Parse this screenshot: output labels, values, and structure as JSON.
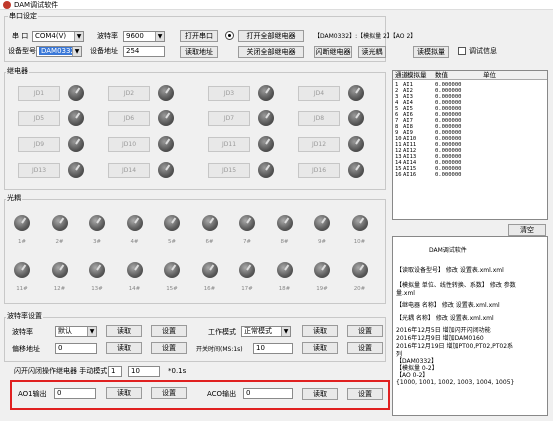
{
  "window": {
    "title": "DAM调试软件"
  },
  "serial": {
    "group_title": "串口设定",
    "port_label": "串  口",
    "port_value": "COM4(V)",
    "baud_label": "波特率",
    "baud_value": "9600",
    "open_port": "打开串口",
    "open_all": "打开全部继电器",
    "status_text": "【DAM0332】:【模拟量 2】【AO 2】",
    "device_model_label": "设备型号",
    "device_model_value": "DAM0332",
    "device_addr_label": "设备地址",
    "device_addr_value": "254",
    "read_addr": "读取地址",
    "close_all": "关闭全部继电器",
    "flash_relay": "闪断继电器",
    "read_optocoupler": "读光耦",
    "read_analog": "读模拟量",
    "debug_info": "调试信息"
  },
  "relays": {
    "group_title": "继电器",
    "items": [
      {
        "label": "JD1"
      },
      {
        "label": "JD2"
      },
      {
        "label": "JD3"
      },
      {
        "label": "JD4"
      },
      {
        "label": "JD5"
      },
      {
        "label": "JD6"
      },
      {
        "label": "JD7"
      },
      {
        "label": "JD8"
      },
      {
        "label": "JD9"
      },
      {
        "label": "JD10"
      },
      {
        "label": "JD11"
      },
      {
        "label": "JD12"
      },
      {
        "label": "JD13"
      },
      {
        "label": "JD14"
      },
      {
        "label": "JD15"
      },
      {
        "label": "JD16"
      }
    ]
  },
  "optocouplers": {
    "group_title": "光耦",
    "labels": [
      "1#",
      "2#",
      "3#",
      "4#",
      "5#",
      "6#",
      "7#",
      "8#",
      "9#",
      "10#",
      "11#",
      "12#",
      "13#",
      "14#",
      "15#",
      "16#",
      "17#",
      "18#",
      "19#",
      "20#"
    ]
  },
  "table": {
    "headers": [
      "通道",
      "模拟量",
      "数值",
      "单位"
    ],
    "rows": [
      {
        "ch": "1",
        "name": "AI1",
        "val": "0.000000"
      },
      {
        "ch": "2",
        "name": "AI2",
        "val": "0.000000"
      },
      {
        "ch": "3",
        "name": "AI3",
        "val": "0.000000"
      },
      {
        "ch": "4",
        "name": "AI4",
        "val": "0.000000"
      },
      {
        "ch": "5",
        "name": "AI5",
        "val": "0.000000"
      },
      {
        "ch": "6",
        "name": "AI6",
        "val": "0.000000"
      },
      {
        "ch": "7",
        "name": "AI7",
        "val": "0.000000"
      },
      {
        "ch": "8",
        "name": "AI8",
        "val": "0.000000"
      },
      {
        "ch": "9",
        "name": "AI9",
        "val": "0.000000"
      },
      {
        "ch": "10",
        "name": "AI10",
        "val": "0.000000"
      },
      {
        "ch": "11",
        "name": "AI11",
        "val": "0.000000"
      },
      {
        "ch": "12",
        "name": "AI12",
        "val": "0.000000"
      },
      {
        "ch": "13",
        "name": "AI13",
        "val": "0.000000"
      },
      {
        "ch": "14",
        "name": "AI14",
        "val": "0.000000"
      },
      {
        "ch": "15",
        "name": "AI15",
        "val": "0.000000"
      },
      {
        "ch": "16",
        "name": "AI16",
        "val": "0.000000"
      }
    ]
  },
  "clear_button": "清空",
  "info": {
    "lines": [
      "DAM调试软件",
      "【读取设备型号】 修改  设置表.xml.xml",
      "【模拟量 单位、线性转换、系数】 修改  参数",
      "量.xml",
      "【继电器 名称】 修改  设置表.xml.xml",
      "【光耦 名称】 修改  设置表.xml.xml",
      "2016年12月5日  增加闪开闪闭功能",
      "2016年12月9日  增加DAM0160",
      "2016年12月19日  增加PT00,PT02,PT02系",
      "列",
      "【DAM0332】",
      "  【模拟量 0-2】",
      "  【AO 0-2】",
      "  {1000, 1001, 1002, 1003, 1004, 1005}"
    ]
  },
  "baud_settings": {
    "group_title": "波特率设置",
    "baud_label": "波特率",
    "baud_value": "默认",
    "read": "读取",
    "set": "设置",
    "mode_label": "工作模式",
    "mode_value": "正常模式",
    "read2": "读取",
    "set2": "设置",
    "addr_label": "偏移地址",
    "addr_value": "0",
    "read3": "读取",
    "set3": "设置",
    "switch_label": "开关时间(MS:1s)",
    "switch_value": "10",
    "read4": "读取",
    "set4": "设置"
  },
  "flash": {
    "label": "闪开闪闭操作继电器 手动模式",
    "select_value": "1",
    "value": "10",
    "unit": "*0.1s"
  },
  "ao": {
    "ao_label": "AO1输出",
    "ao_value": "0",
    "read": "读取",
    "set": "设置",
    "aco_label": "ACO输出",
    "aco_value": "0",
    "read2": "读取",
    "set2": "设置"
  }
}
